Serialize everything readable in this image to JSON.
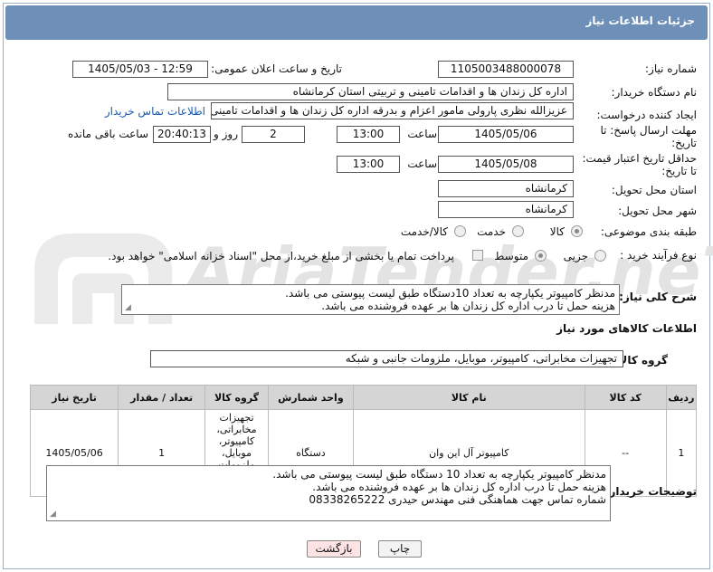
{
  "header": {
    "title": "جزئیات اطلاعات نیاز"
  },
  "fields": {
    "need_number_label": "شماره نیاز:",
    "need_number": "1105003488000078",
    "announce_label": "تاریخ و ساعت اعلان عمومی:",
    "announce_value": "1405/05/03 - 12:59",
    "buyer_label": "نام دستگاه خریدار:",
    "buyer_value": "اداره کل زندان ها و اقدامات تامینی و تربیتی استان کرمانشاه",
    "creator_label": "ایجاد کننده درخواست:",
    "creator_value": "عزیزالله نظری پارولی مامور اعزام و بدرقه اداره کل زندان ها و اقدامات تامینی و تر",
    "contact_link": "اطلاعات تماس خریدار",
    "deadline_label_1": "مهلت ارسال پاسخ: تا",
    "deadline_label_2": "تاریخ:",
    "deadline_date": "1405/05/06",
    "time_word": "ساعت",
    "deadline_time": "13:00",
    "days_value": "2",
    "days_word": "روز و",
    "remain_time": "20:40:13",
    "remain_word": "ساعت باقی مانده",
    "price_label_1": "حداقل تاریخ اعتبار قیمت:",
    "price_label_2": "تا تاریخ:",
    "price_date": "1405/05/08",
    "price_time": "13:00",
    "province_label": "استان محل تحویل:",
    "province_value": "کرمانشاه",
    "city_label": "شهر محل تحویل:",
    "city_value": "کرمانشاه",
    "category_label": "طبقه بندی موضوعی:",
    "cat_goods": "کالا",
    "cat_service": "خدمت",
    "cat_goods_service": "کالا/خدمت",
    "process_label": "نوع فرآیند خرید :",
    "proc_partial": "جزیی",
    "proc_medium": "متوسط",
    "payment_text": "پرداخت تمام یا بخشی از مبلغ خرید،از محل \"اسناد خزانه اسلامی\" خواهد بود."
  },
  "summary": {
    "label": "شرح کلی نیاز:",
    "line1": "مدنظر کامپیوتر یکپارچه به تعداد 10دستگاه طبق لیست پیوستی می باشد.",
    "line2": "هزینه حمل تا درب اداره کل زندان ها بر عهده فروشنده می باشد."
  },
  "goods_section_title": "اطلاعات کالاهای مورد نیاز",
  "goods_group": {
    "label": "گروه کالا:",
    "value": "تجهیزات مخابراتی، کامپیوتر، موبایل، ملزومات جانبی و شبکه"
  },
  "table": {
    "headers": [
      "ردیف",
      "کد کالا",
      "نام کالا",
      "واحد شمارش",
      "گروه کالا",
      "تعداد / مقدار",
      "تاریخ نیاز"
    ],
    "rows": [
      [
        "1",
        "--",
        "کامپیوتر آل این وان",
        "دستگاه",
        "تجهیزات مخابراتی، کامپیوتر، موبایل، ملزومات جانبی و شبکه",
        "1",
        "1405/05/06"
      ]
    ]
  },
  "buyer_notes": {
    "label": "توضیحات خریدار:",
    "line1": "مدنظر کامپیوتر یکپارچه به تعداد 10 دستگاه طبق لیست پیوستی می باشد.",
    "line2": "هزینه حمل تا درب اداره کل زندان ها بر عهده فروشنده می باشد.",
    "line3": "شماره تماس جهت هماهنگی فنی  مهندس حیدری 08338265222"
  },
  "buttons": {
    "print": "چاپ",
    "back": "بازگشت"
  },
  "watermark": "AriaTender.neT",
  "colors": {
    "header": "#6d8fb8",
    "link": "#1a5cb0",
    "back_button_bg": "#fde3e3",
    "table_header": "#d5d5d5"
  }
}
